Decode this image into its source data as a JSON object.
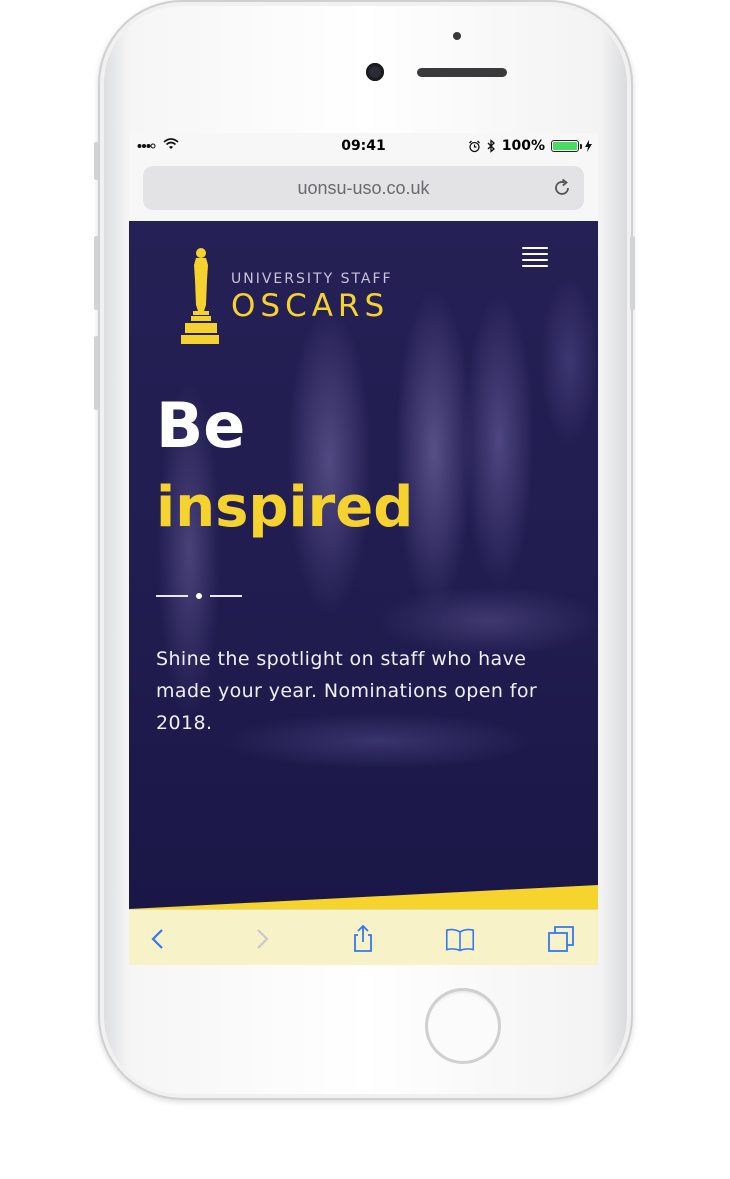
{
  "status_bar": {
    "time": "09:41",
    "battery": "100%",
    "battery_level": 1.0,
    "icons": [
      "signal-icon",
      "wifi-icon",
      "alarm-icon",
      "bluetooth-icon",
      "battery-icon",
      "charging-icon"
    ]
  },
  "browser": {
    "url": "uonsu-uso.co.uk",
    "reload_icon": "reload-icon",
    "toolbar_icons": [
      "back-icon",
      "forward-icon",
      "share-icon",
      "bookmarks-icon",
      "tabs-icon"
    ]
  },
  "site": {
    "logo_line1": "UNIVERSITY STAFF",
    "logo_line2": "OSCARS",
    "menu_icon": "hamburger-menu-icon",
    "hero_word1": "Be",
    "hero_word2": "inspired",
    "hero_text": "Shine the spotlight on staff who have made your year. Nominations open for 2018."
  },
  "colors": {
    "accent": "#f5d22d",
    "background": "#211d50",
    "toolbar": "#f8f2c8",
    "link_blue": "#3478f6"
  }
}
